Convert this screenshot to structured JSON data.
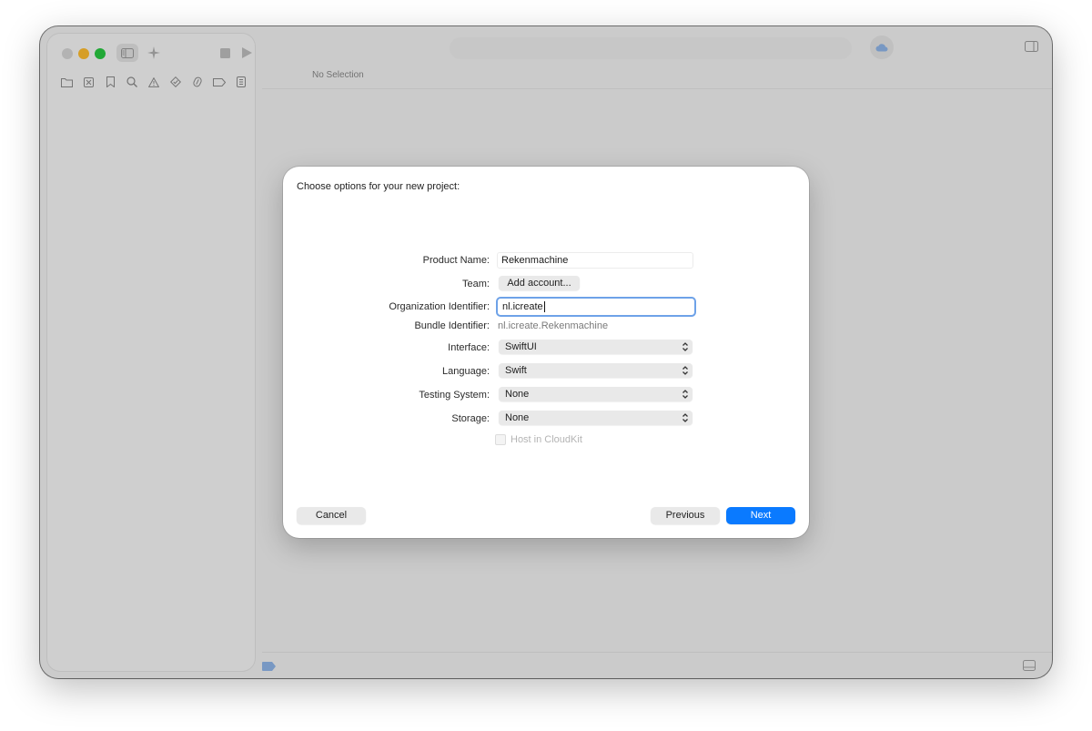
{
  "window": {
    "toolbar": {
      "traffic_lights": [
        "close",
        "minimize",
        "zoom"
      ],
      "icons": [
        "sidebar-toggle-icon",
        "sparkle-icon",
        "stop-icon",
        "run-icon",
        "cloud-icon",
        "inspector-toggle-icon"
      ]
    },
    "navigator_icons": [
      "folder-icon",
      "source-control-icon",
      "bookmark-icon",
      "search-icon",
      "warning-icon",
      "test-icon",
      "debug-icon",
      "breakpoint-icon",
      "report-icon"
    ],
    "editor": {
      "status": "No Selection"
    }
  },
  "dialog": {
    "title": "Choose options for your new project:",
    "fields": {
      "product_name": {
        "label": "Product Name:",
        "value": "Rekenmachine"
      },
      "team": {
        "label": "Team:",
        "button": "Add account..."
      },
      "org_id": {
        "label": "Organization Identifier:",
        "value": "nl.icreate"
      },
      "bundle_id": {
        "label": "Bundle Identifier:",
        "value": "nl.icreate.Rekenmachine"
      },
      "interface": {
        "label": "Interface:",
        "value": "SwiftUI"
      },
      "language": {
        "label": "Language:",
        "value": "Swift"
      },
      "testing": {
        "label": "Testing System:",
        "value": "None"
      },
      "storage": {
        "label": "Storage:",
        "value": "None"
      }
    },
    "checkbox": {
      "label": "Host in CloudKit",
      "checked": false,
      "enabled": false
    },
    "buttons": {
      "cancel": "Cancel",
      "previous": "Previous",
      "next": "Next"
    }
  },
  "colors": {
    "accent": "#0a7aff",
    "focus_ring": "#6ea2e8",
    "minimize": "#febc2e",
    "zoom": "#28c840"
  }
}
